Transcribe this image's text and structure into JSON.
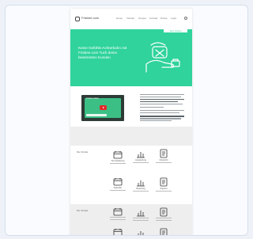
{
  "site": {
    "brand": "Frisbee.com",
    "nav": [
      "Home",
      "Vorteile",
      "Gruppe",
      "Kontakt",
      "Preise",
      "Login"
    ]
  },
  "hero": {
    "title": "Keine Gefühls-Achterbahn mit Frisbee.com Tuch deine bestimmten Kunden",
    "banner": "Jetzt starten",
    "color": "#2fd39b"
  },
  "video": {
    "title": "Frisbee Video"
  },
  "sections": {
    "features_label": "Die Vorteile",
    "features2_label": "Die Vorteile",
    "features": [
      {
        "title": "Termin­planung",
        "icon": "calendar-icon"
      },
      {
        "title": "Auswertung",
        "icon": "chart-icon"
      },
      {
        "title": "Übersicht",
        "icon": "document-icon"
      },
      {
        "title": "Kalender",
        "icon": "calendar-icon"
      },
      {
        "title": "Reporting",
        "icon": "chart-icon"
      },
      {
        "title": "Support",
        "icon": "document-icon"
      }
    ]
  }
}
